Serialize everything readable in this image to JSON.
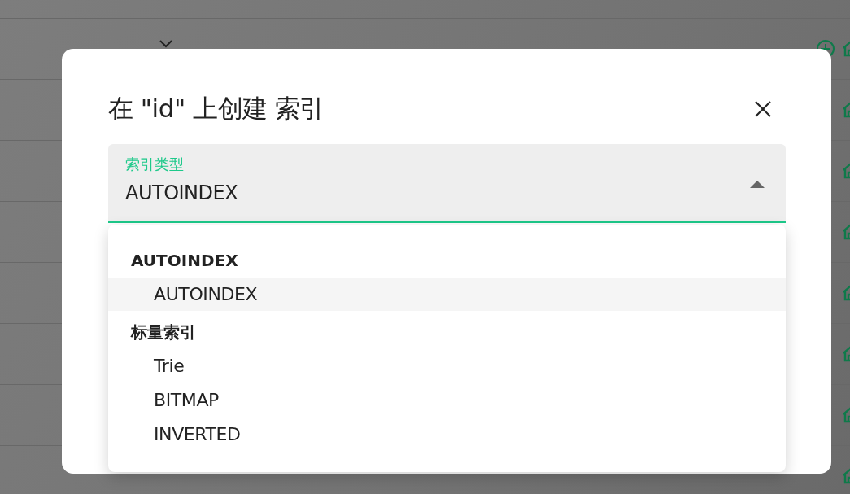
{
  "dialog": {
    "title": "在 \"id\" 上创建 索引",
    "field": {
      "label": "索引类型",
      "value": "AUTOINDEX",
      "expanded": true
    },
    "menu": {
      "groups": [
        {
          "header": "AUTOINDEX",
          "options": [
            {
              "label": "AUTOINDEX",
              "selected": true
            }
          ]
        },
        {
          "header": "标量索引",
          "options": [
            {
              "label": "Trie",
              "selected": false
            },
            {
              "label": "BITMAP",
              "selected": false
            },
            {
              "label": "INVERTED",
              "selected": false
            }
          ]
        }
      ]
    }
  }
}
